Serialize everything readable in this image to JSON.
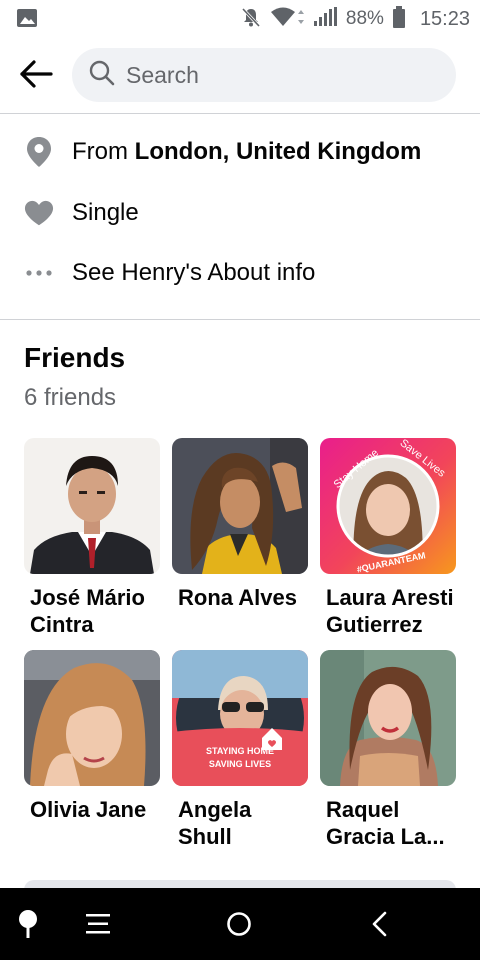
{
  "status_bar": {
    "battery_pct": "88%",
    "time": "15:23"
  },
  "header": {
    "search_placeholder": "Search"
  },
  "info": {
    "from_prefix": "From ",
    "from_place": "London, United Kingdom",
    "relationship": "Single",
    "about_link": "See Henry's About info"
  },
  "friends": {
    "title": "Friends",
    "count_label": "6 friends",
    "items": [
      {
        "name": "José Mário Cintra"
      },
      {
        "name": "Rona Alves"
      },
      {
        "name": "Laura Aresti Gutierrez",
        "frame_text_top": "Stay Home",
        "frame_text_right": "Save Lives",
        "frame_text_bottom": "#QUARANTEAM"
      },
      {
        "name": "Olivia Jane"
      },
      {
        "name": "Angela Shull",
        "frame_text_1": "STAYING HOME",
        "frame_text_2": "SAVING LIVES"
      },
      {
        "name": "Raquel Gracia La..."
      }
    ]
  },
  "icons": {
    "status_left": "image-icon",
    "mute": "bell-off-icon",
    "wifi": "wifi-icon",
    "signal": "signal-icon",
    "battery": "battery-icon",
    "back": "arrow-left-icon",
    "search": "search-icon",
    "location": "location-pin-icon",
    "heart": "heart-icon",
    "more": "more-dots-icon"
  },
  "colors": {
    "accent_gray": "#65676b",
    "divider": "#d0d2d6",
    "search_bg": "#f0f2f5"
  }
}
